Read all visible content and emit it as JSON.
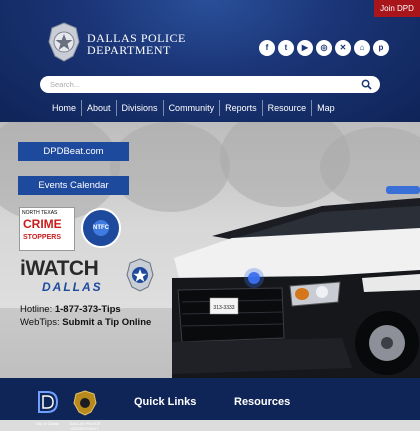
{
  "header": {
    "join_label": "Join DPD",
    "dept_line1": "DALLAS POLICE",
    "dept_line2": "DEPARTMENT",
    "social": [
      {
        "name": "facebook-icon",
        "glyph": "f"
      },
      {
        "name": "twitter-icon",
        "glyph": "t"
      },
      {
        "name": "youtube-icon",
        "glyph": "▶"
      },
      {
        "name": "instagram-icon",
        "glyph": "◎"
      },
      {
        "name": "x-icon",
        "glyph": "✕"
      },
      {
        "name": "home-icon",
        "glyph": "⌂"
      },
      {
        "name": "pinterest-icon",
        "glyph": "p"
      }
    ]
  },
  "search": {
    "placeholder": "Search..."
  },
  "nav": [
    "Home",
    "About",
    "Divisions",
    "Community",
    "Reports",
    "Resource",
    "Map"
  ],
  "hero": {
    "button1": "DPDBeat.com",
    "button2": "Events Calendar",
    "crime_stoppers_top": "NORTH TEXAS",
    "crime_stoppers_line1": "CRIME",
    "crime_stoppers_line2": "STOPPERS",
    "ntfc_label": "NTFC",
    "iwatch_text": "iWATCH",
    "iwatch_sub": "DALLAS",
    "hotline_label": "Hotline:",
    "hotline_value": "1-877-373-Tips",
    "webtips_label": "WebTips:",
    "webtips_value": "Submit a Tip Online",
    "plate": "313-3333"
  },
  "footer": {
    "city_caption": "City of Dallas",
    "dept_caption": "DALLAS POLICE DEPARTMENT",
    "quick_links": "Quick Links",
    "resources": "Resources"
  },
  "colors": {
    "header_blue": "#1a3475",
    "button_blue": "#1e4a9e",
    "join_red": "#a8161b",
    "footer_navy": "#0f2457"
  }
}
